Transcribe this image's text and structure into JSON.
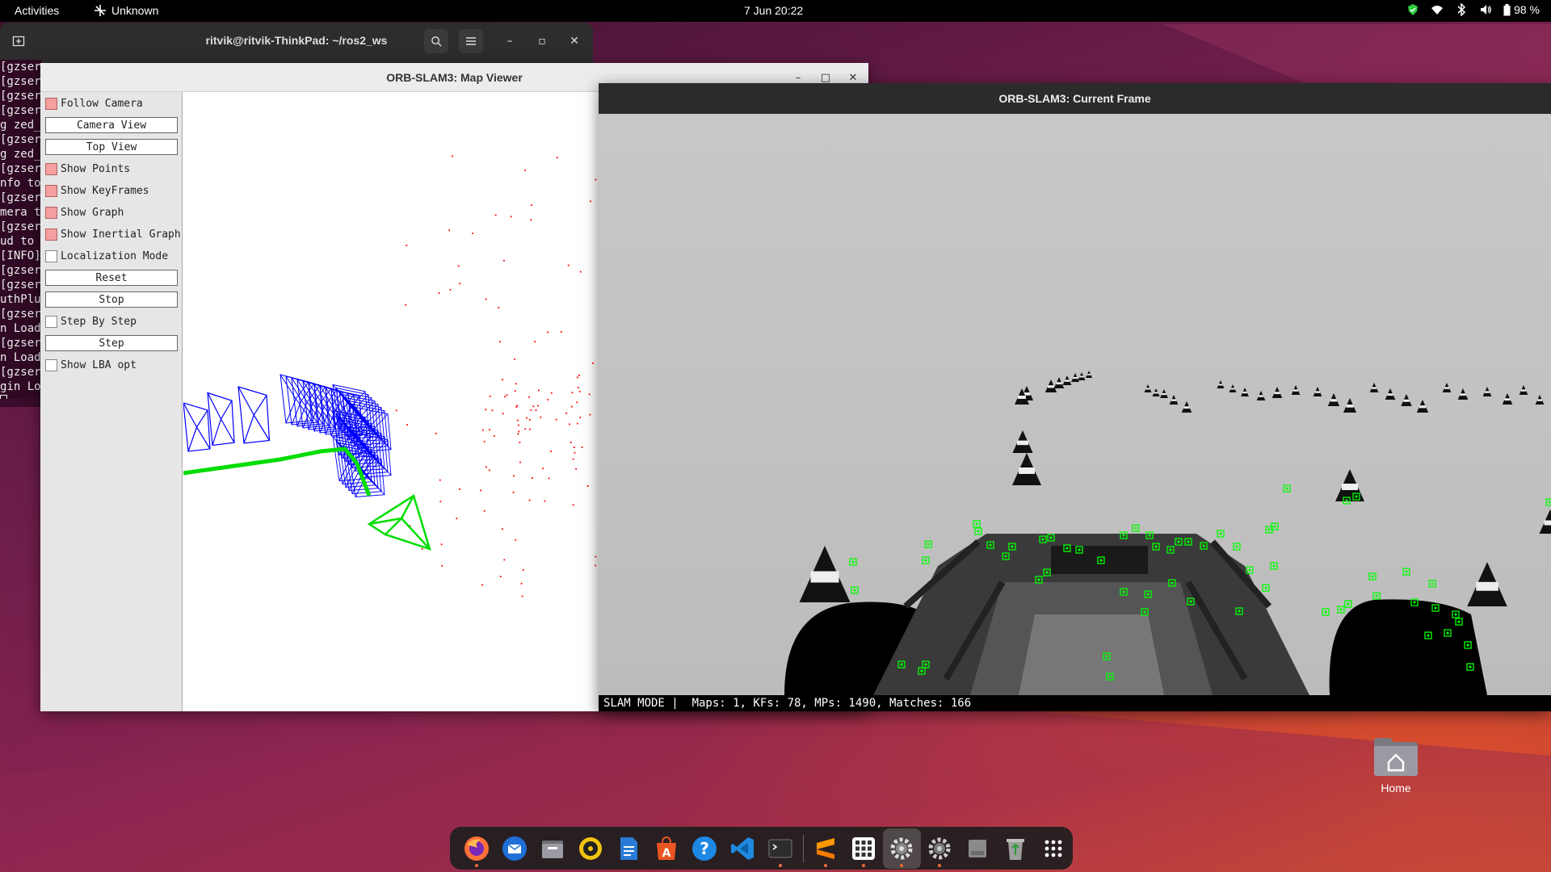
{
  "topbar": {
    "activities": "Activities",
    "app_name": "Unknown",
    "clock": "7 Jun  20:22",
    "battery": "98 %"
  },
  "terminal": {
    "title": "ritvik@ritvik-ThinkPad: ~/ros2_ws",
    "lines": [
      "[gzser",
      "[gzser",
      "[gzser",
      "[gzser",
      "g zed_",
      "[gzser",
      "g zed_",
      "[gzser",
      "nfo to",
      "[gzser",
      "mera t",
      "[gzser",
      "ud to",
      "[INFO]",
      "[gzser",
      "[gzser",
      "uthPlu",
      "[gzser",
      "n Load",
      "[gzser",
      "n Load",
      "[gzser",
      "gin Lo"
    ]
  },
  "map_viewer": {
    "title": "ORB-SLAM3: Map Viewer",
    "follow_camera": "Follow Camera",
    "camera_view": "Camera View",
    "top_view": "Top View",
    "show_points": "Show Points",
    "show_keyframes": "Show KeyFrames",
    "show_graph": "Show Graph",
    "show_inertial_graph": "Show Inertial Graph",
    "localization_mode": "Localization Mode",
    "reset": "Reset",
    "stop": "Stop",
    "step_by_step": "Step By Step",
    "step": "Step",
    "show_lba_opt": "Show LBA opt"
  },
  "current_frame": {
    "title": "ORB-SLAM3: Current Frame",
    "status": "SLAM MODE |  Maps: 1, KFs: 78, MPs: 1490, Matches: 166"
  },
  "desktop": {
    "home_label": "Home"
  },
  "dock": {
    "items": [
      "firefox-icon",
      "thunderbird-icon",
      "files-icon",
      "rhythmbox-icon",
      "writer-icon",
      "app-center-icon",
      "help-icon",
      "vscode-icon",
      "terminal-icon",
      "sublime-icon",
      "grid-app-icon",
      "settings-icon",
      "settings-icon",
      "disk-icon",
      "trash-icon",
      "show-apps-icon"
    ]
  },
  "colors": {
    "keyframe_blue": "#0000ff",
    "graph_green": "#00dd00",
    "map_point_red": "#ff0000",
    "feature_green": "#00ff00",
    "ubuntu_orange": "#e95420"
  }
}
